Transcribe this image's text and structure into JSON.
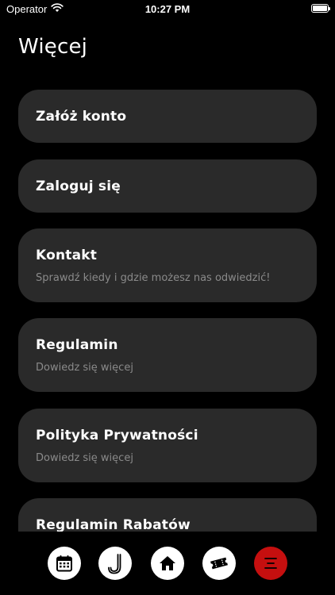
{
  "status_bar": {
    "carrier": "Operator",
    "time": "10:27 PM"
  },
  "page": {
    "title": "Więcej"
  },
  "menu": [
    {
      "title": "Załóż konto"
    },
    {
      "title": "Zaloguj się"
    },
    {
      "title": "Kontakt",
      "subtitle": "Sprawdź kiedy i gdzie możesz nas odwiedzić!"
    },
    {
      "title": "Regulamin",
      "subtitle": "Dowiedz się więcej"
    },
    {
      "title": "Polityka Prywatności",
      "subtitle": "Dowiedz się więcej"
    },
    {
      "title": "Regulamin Rabatów"
    }
  ],
  "tab_bar": {
    "items": [
      {
        "icon": "calendar-icon"
      },
      {
        "icon": "logo-j-icon"
      },
      {
        "icon": "home-icon"
      },
      {
        "icon": "ticket-icon"
      },
      {
        "icon": "menu-icon",
        "active": true
      }
    ]
  },
  "colors": {
    "background": "#000000",
    "card": "#2a2a2a",
    "subtitle": "#8a8a8a",
    "active_tab": "#c50f0f",
    "tab": "#ffffff"
  }
}
